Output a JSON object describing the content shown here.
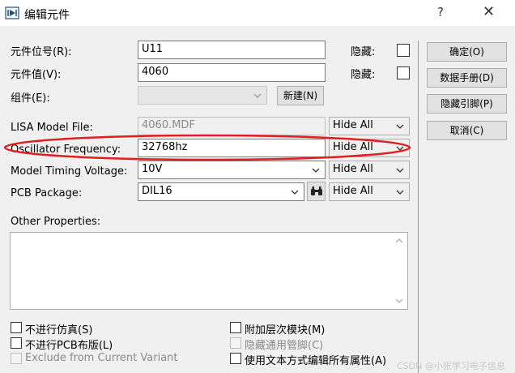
{
  "window": {
    "title": "编辑元件",
    "help": "?",
    "close": "✕"
  },
  "fields": {
    "ref_label": "元件位号(R):",
    "ref_value": "U11",
    "ref_hidden_label": "隐藏:",
    "value_label": "元件值(V):",
    "value_value": "4060",
    "value_hidden_label": "隐藏:",
    "group_label": "组件(E):",
    "group_value": "",
    "new_button": "新建(N)"
  },
  "properties": [
    {
      "label": "LISA Model File:",
      "value": "4060.MDF",
      "visibility": "Hide All"
    },
    {
      "label": "Oscillator Frequency:",
      "value": "32768hz",
      "visibility": "Hide All"
    },
    {
      "label": "Model Timing Voltage:",
      "value": "10V",
      "visibility": "Hide All"
    },
    {
      "label": "PCB Package:",
      "value": "DIL16",
      "visibility": "Hide All"
    }
  ],
  "other_properties": {
    "label": "Other Properties:",
    "text": ""
  },
  "buttons": {
    "ok": "确定(O)",
    "datasheet": "数据手册(D)",
    "hidden_pins": "隐藏引脚(P)",
    "cancel": "取消(C)"
  },
  "options": {
    "no_simulate": "不进行仿真(S)",
    "no_pcb": "不进行PCB布版(L)",
    "exclude_variant": "Exclude from Current Variant",
    "hier_module": "附加层次模块(M)",
    "hide_common_pins": "隐藏通用管脚(C)",
    "edit_all_text": "使用文本方式编辑所有属性(A)"
  },
  "watermark": "CSDN @小张学习电子信息",
  "annotation_color": "#e02020"
}
